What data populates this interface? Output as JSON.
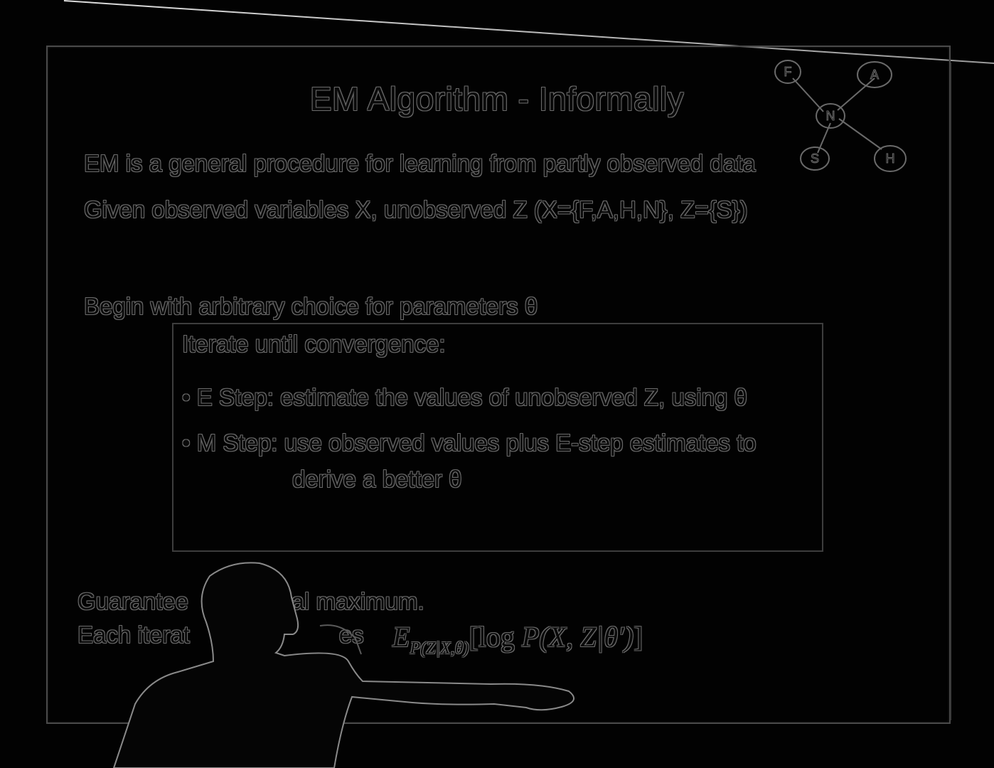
{
  "slide": {
    "title": "EM Algorithm - Informally",
    "line1": "EM is a general procedure for learning from partly observed data",
    "line2": "Given  observed variables X, unobserved Z  (X={F,A,H,N}, Z={S})",
    "line3": "Begin with arbitrary choice for parameters θ",
    "iterate_heading": "Iterate until convergence:",
    "e_step": "• E Step: estimate the values of unobserved Z, using θ",
    "m_step": "• M Step: use observed values plus E-step estimates to",
    "m_step_cont": "derive a better θ",
    "guarantee_line_a": "Guarantee",
    "guarantee_line_b": "d local maximum.",
    "each_line_a": "Each iterat",
    "each_line_b": "es",
    "formula": {
      "expectation": "E",
      "subscript": "P(Z|X,θ)",
      "bracket_open": "[log ",
      "prob": "P",
      "args": "(X, Z|θ′)",
      "bracket_close": "]"
    }
  },
  "graph_nodes": [
    {
      "label": "F"
    },
    {
      "label": "A"
    },
    {
      "label": "N"
    },
    {
      "label": "S"
    },
    {
      "label": "H"
    }
  ],
  "colors": {
    "background": "#000000",
    "edge_glow": "#6a6a6a",
    "projector_line": "#dcdcdc"
  }
}
